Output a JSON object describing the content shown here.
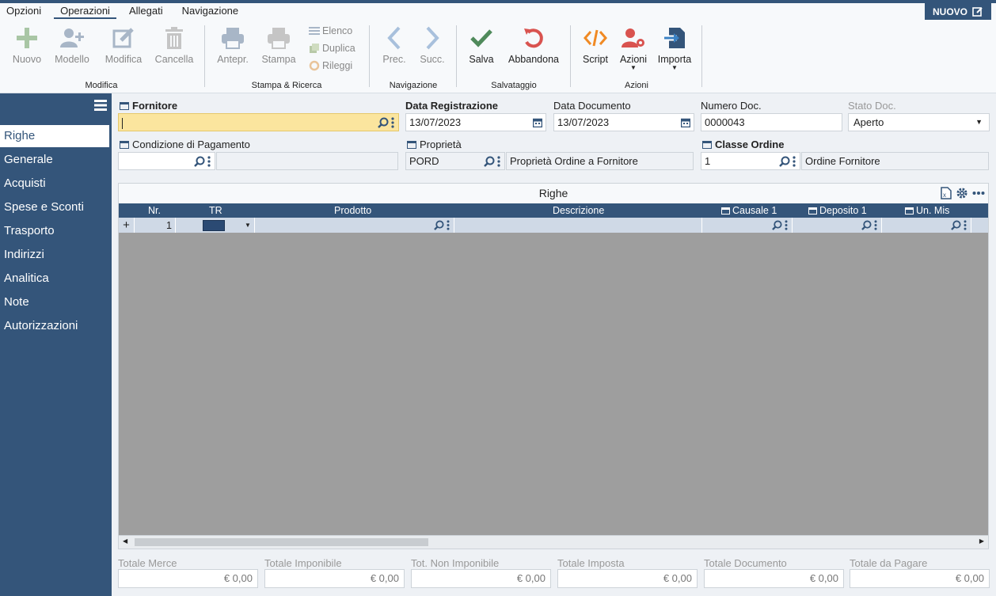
{
  "menu": [
    "Opzioni",
    "Operazioni",
    "Allegati",
    "Navigazione"
  ],
  "new_button": "NUOVO",
  "toolbar": {
    "modifica_group": "Modifica",
    "nuovo": "Nuovo",
    "modello": "Modello",
    "modifica": "Modifica",
    "cancella": "Cancella",
    "stampa_group": "Stampa & Ricerca",
    "antepr": "Antepr.",
    "stampa": "Stampa",
    "elenco": "Elenco",
    "duplica": "Duplica",
    "rileggi": "Rileggi",
    "nav_group": "Navigazione",
    "prec": "Prec.",
    "succ": "Succ.",
    "salv_group": "Salvataggio",
    "salva": "Salva",
    "abbandona": "Abbandona",
    "azioni_group": "Azioni",
    "script": "Script",
    "azioni": "Azioni",
    "importa": "Importa"
  },
  "sidebar": [
    "Righe",
    "Generale",
    "Acquisti",
    "Spese e Sconti",
    "Trasporto",
    "Indirizzi",
    "Analitica",
    "Note",
    "Autorizzazioni"
  ],
  "form": {
    "fornitore_label": "Fornitore",
    "fornitore_value": "",
    "data_reg_label": "Data Registrazione",
    "data_reg_value": "13/07/2023",
    "data_doc_label": "Data Documento",
    "data_doc_value": "13/07/2023",
    "num_doc_label": "Numero Doc.",
    "num_doc_value": "0000043",
    "stato_doc_label": "Stato Doc.",
    "stato_doc_value": "Aperto",
    "cond_pag_label": "Condizione di Pagamento",
    "cond_pag_value": "",
    "cond_pag_desc": "",
    "proprieta_label": "Proprietà",
    "proprieta_value": "PORD",
    "proprieta_desc": "Proprietà Ordine a Fornitore",
    "classe_label": "Classe Ordine",
    "classe_value": "1",
    "classe_desc": "Ordine Fornitore"
  },
  "grid": {
    "title": "Righe",
    "columns": [
      "Nr.",
      "TR",
      "Prodotto",
      "Descrizione",
      "Causale 1",
      "Deposito 1",
      "Un. Mis"
    ],
    "row": {
      "add": "+",
      "nr": "1"
    }
  },
  "totals": [
    {
      "label": "Totale Merce",
      "value": "€ 0,00"
    },
    {
      "label": "Totale Imponibile",
      "value": "€ 0,00"
    },
    {
      "label": "Tot. Non Imponibile",
      "value": "€ 0,00"
    },
    {
      "label": "Totale Imposta",
      "value": "€ 0,00"
    },
    {
      "label": "Totale Documento",
      "value": "€ 0,00"
    },
    {
      "label": "Totale da Pagare",
      "value": "€ 0,00"
    }
  ],
  "colors": {
    "primary": "#34557a",
    "highlight": "#fbe59e",
    "grid_bg": "#9e9e9e",
    "row_bg": "#cfd9e6"
  }
}
